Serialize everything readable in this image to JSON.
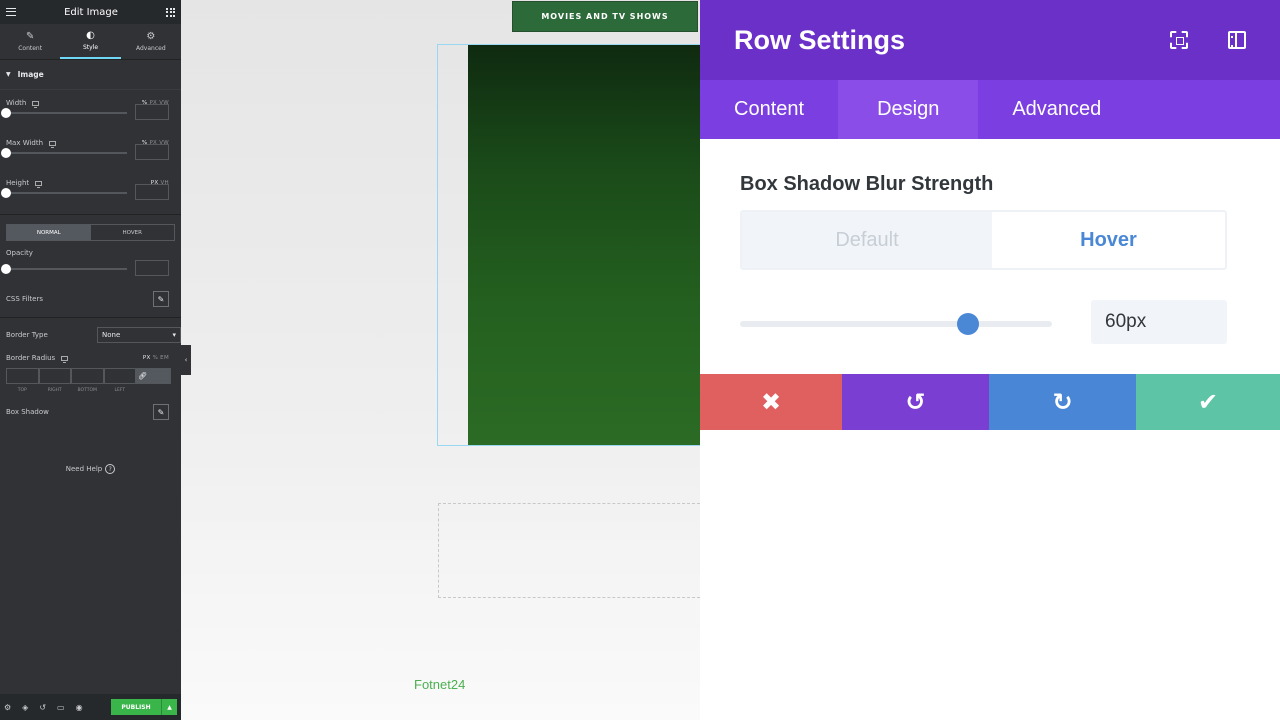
{
  "left_panel": {
    "title": "Edit Image",
    "tabs": [
      {
        "label": "Content",
        "glyph": "✎"
      },
      {
        "label": "Style",
        "glyph": "◐"
      },
      {
        "label": "Advanced",
        "glyph": "⚙"
      }
    ],
    "section_title": "Image",
    "width": {
      "label": "Width",
      "units": [
        "%",
        "PX",
        "VW"
      ]
    },
    "max_width": {
      "label": "Max Width",
      "units": [
        "%",
        "PX",
        "VW"
      ]
    },
    "height": {
      "label": "Height",
      "units": [
        "PX",
        "VH"
      ]
    },
    "state_tabs": {
      "normal": "NORMAL",
      "hover": "HOVER"
    },
    "opacity_label": "Opacity",
    "css_filters_label": "CSS Filters",
    "border_type": {
      "label": "Border Type",
      "value": "None"
    },
    "border_radius": {
      "label": "Border Radius",
      "units": [
        "PX",
        "%",
        "EM"
      ],
      "sides": [
        "TOP",
        "RIGHT",
        "BOTTOM",
        "LEFT"
      ]
    },
    "box_shadow_label": "Box Shadow",
    "need_help": "Need Help",
    "publish_label": "PUBLISH"
  },
  "canvas": {
    "menu_button": "MOVIES AND TV SHOWS",
    "footer_logo": "Fotnet24"
  },
  "row_settings": {
    "title": "Row Settings",
    "tabs": [
      "Content",
      "Design",
      "Advanced"
    ],
    "active_tab": "Design",
    "field_label": "Box Shadow Blur Strength",
    "state_default": "Default",
    "state_hover": "Hover",
    "active_state": "Hover",
    "blur_value": "60px",
    "slider_fraction": 0.73,
    "actions": {
      "cancel": "✖",
      "undo": "↺",
      "redo": "↻",
      "save": "✔"
    }
  },
  "colors": {
    "divi_purple": "#6b30c8",
    "divi_tab_purple": "#7b3ee0",
    "divi_blue": "#4a88d6",
    "cancel_red": "#e06060",
    "save_green": "#5ec4a6",
    "elementor_dark": "#303236",
    "publish_green": "#39b54a"
  }
}
